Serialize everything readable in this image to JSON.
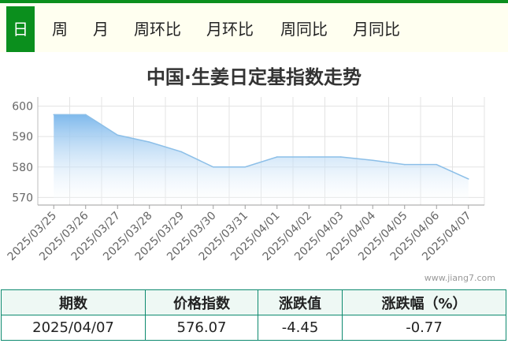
{
  "tabs": [
    {
      "label": "日",
      "active": true
    },
    {
      "label": "周",
      "active": false
    },
    {
      "label": "月",
      "active": false
    },
    {
      "label": "周环比",
      "active": false
    },
    {
      "label": "月环比",
      "active": false
    },
    {
      "label": "周同比",
      "active": false
    },
    {
      "label": "月同比",
      "active": false
    }
  ],
  "colors": {
    "accent": "#0b8f1d",
    "area_top": "#7fb9ec",
    "line": "#8cbfe8",
    "table_border": "#0d8a6f"
  },
  "chart_data": {
    "type": "area",
    "title": "中国·生姜日定基指数走势",
    "categories": [
      "2025/03/25",
      "2025/03/26",
      "2025/03/27",
      "2025/03/28",
      "2025/03/29",
      "2025/03/30",
      "2025/03/31",
      "2025/04/01",
      "2025/04/02",
      "2025/04/03",
      "2025/04/04",
      "2025/04/05",
      "2025/04/06",
      "2025/04/07"
    ],
    "series": [
      {
        "values": [
          597.2,
          597.2,
          590.5,
          588.2,
          585.0,
          580.0,
          580.0,
          583.3,
          583.3,
          583.3,
          582.2,
          580.8,
          580.8,
          576.07
        ]
      }
    ],
    "ylim": [
      567.5,
      603
    ],
    "yticks": [
      570,
      580,
      590,
      600
    ],
    "grid": true,
    "legend": "none"
  },
  "watermark": "www.jiang7.com",
  "table": {
    "headers": [
      "期数",
      "价格指数",
      "涨跌值",
      "涨跌幅（%）"
    ],
    "row": [
      "2025/04/07",
      "576.07",
      "-4.45",
      "-0.77"
    ]
  }
}
